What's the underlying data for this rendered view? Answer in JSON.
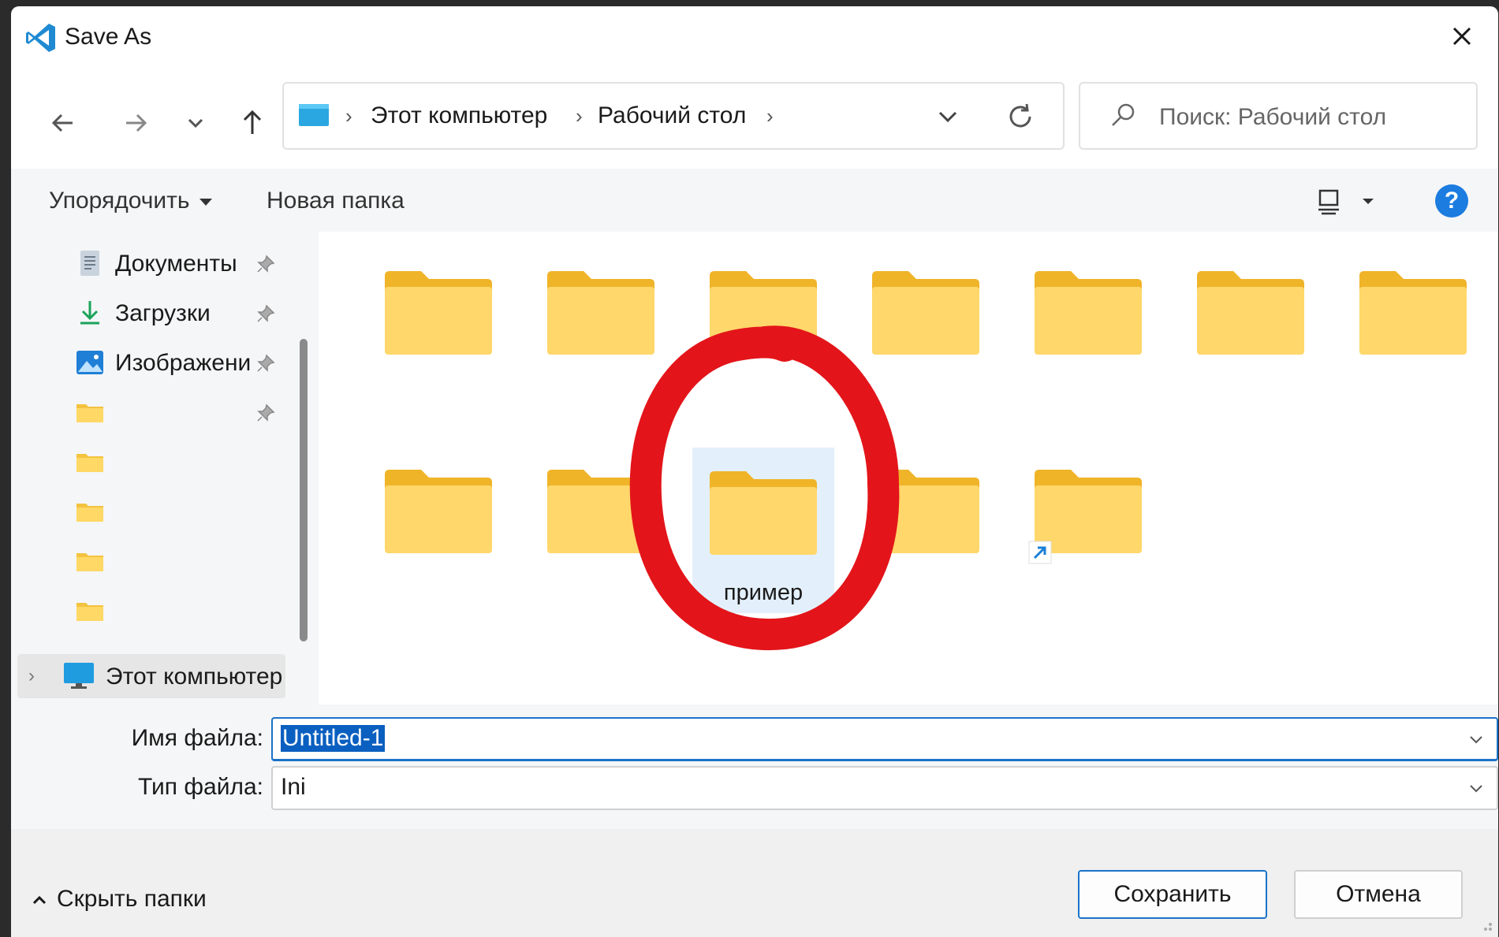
{
  "window": {
    "title": "Save As",
    "accent_color": "#1a73c8",
    "icon": "vscode-icon"
  },
  "nav": {
    "back": "arrow-left-icon",
    "forward": "arrow-right-icon",
    "recent": "chevron-down-icon",
    "up": "arrow-up-icon"
  },
  "address": {
    "segments": [
      "Этот компьютер",
      "Рабочий стол"
    ],
    "separator": "›"
  },
  "search": {
    "placeholder": "Поиск: Рабочий стол"
  },
  "toolbar": {
    "organize_label": "Упорядочить",
    "new_folder_label": "Новая папка",
    "help_label": "?"
  },
  "sidebar": {
    "items": [
      {
        "label": "Документы",
        "icon": "documents-icon",
        "pinned": true
      },
      {
        "label": "Загрузки",
        "icon": "downloads-icon",
        "pinned": true
      },
      {
        "label": "Изображени",
        "icon": "pictures-icon",
        "pinned": true
      },
      {
        "label": "",
        "icon": "folder-icon",
        "pinned": true
      },
      {
        "label": "",
        "icon": "folder-icon",
        "pinned": false
      },
      {
        "label": "",
        "icon": "folder-icon",
        "pinned": false
      },
      {
        "label": "",
        "icon": "folder-icon",
        "pinned": false
      },
      {
        "label": "",
        "icon": "folder-icon",
        "pinned": false
      }
    ],
    "this_pc_label": "Этот компьютер"
  },
  "content": {
    "folders": [
      {
        "name": ""
      },
      {
        "name": ""
      },
      {
        "name": ""
      },
      {
        "name": ""
      },
      {
        "name": ""
      },
      {
        "name": ""
      },
      {
        "name": ""
      },
      {
        "name": ""
      },
      {
        "name": ""
      },
      {
        "name": "пример",
        "selected": true
      },
      {
        "name": ""
      },
      {
        "name": "",
        "shortcut": true
      }
    ],
    "annotation": "red-circle-annotation"
  },
  "fields": {
    "filename_label": "Имя файла:",
    "filename_value": "Untitled-1",
    "filetype_label": "Тип файла:",
    "filetype_value": "Ini"
  },
  "footer": {
    "hide_folders_label": "Скрыть папки",
    "save_label": "Сохранить",
    "cancel_label": "Отмена"
  }
}
